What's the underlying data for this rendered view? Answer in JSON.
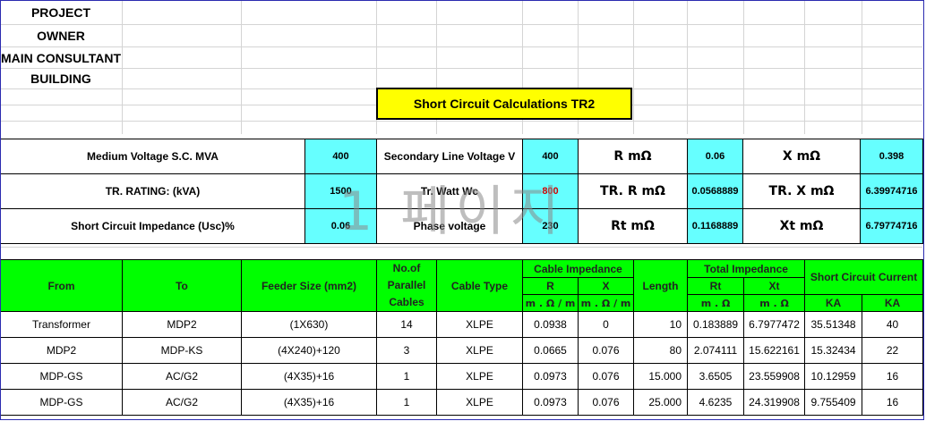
{
  "info_labels": [
    "PROJECT",
    "OWNER",
    "MAIN CONSULTANT",
    "BUILDING"
  ],
  "title": "Short Circuit Calculations TR2",
  "params": {
    "mv_label": "Medium Voltage S.C. MVA",
    "mv_value": "400",
    "slv_label": "Secondary Line Voltage V",
    "slv_value": "400",
    "r_label": "R  mΩ",
    "r_value": "0.06",
    "x_label": "X  mΩ",
    "x_value": "0.398",
    "rating_label": "TR. RATING: (kVA)",
    "rating_value": "1500",
    "watt_label": "Tr. Watt Wc",
    "watt_value": "800",
    "trr_label": "TR. R  mΩ",
    "trr_value": "0.0568889",
    "trx_label": "TR. X  mΩ",
    "trx_value": "6.39974716",
    "usc_label": "Short Circuit Impedance (Usc)%",
    "usc_value": "0.06",
    "phase_label": "Phase voltage",
    "phase_value": "230",
    "rt_label": "Rt   mΩ",
    "rt_value": "0.1168889",
    "xt_label": "Xt   mΩ",
    "xt_value": "6.79774716"
  },
  "watermark": "1 페이지",
  "feeder_headers": {
    "from": "From",
    "to": "To",
    "feeder_size": "Feeder Size (mm2)",
    "parallel": "No.of Parallel Cables",
    "cable_type": "Cable Type",
    "cable_impedance": "Cable Impedance",
    "r": "R",
    "x": "X",
    "r_unit": "m . Ω / m",
    "x_unit": "m . Ω / m",
    "length": "Length",
    "total_impedance": "Total Impedance",
    "rt": "Rt",
    "xt": "Xt",
    "rt_unit": "m . Ω",
    "xt_unit": "m . Ω",
    "sc_current": "Short Circuit Current",
    "ka1": "KA",
    "ka2": "KA"
  },
  "feeder_rows": [
    {
      "from": "Transformer",
      "to": "MDP2",
      "size": "(1X630)",
      "parallel": "14",
      "type": "XLPE",
      "r": "0.0938",
      "x": "0",
      "length": "10",
      "rt": "0.183889",
      "xt": "6.7977472",
      "ka": "35.51348",
      "ka_rated": "40"
    },
    {
      "from": "MDP2",
      "to": "MDP-KS",
      "size": "(4X240)+120",
      "parallel": "3",
      "type": "XLPE",
      "r": "0.0665",
      "x": "0.076",
      "length": "80",
      "rt": "2.074111",
      "xt": "15.622161",
      "ka": "15.32434",
      "ka_rated": "22"
    },
    {
      "from": "MDP-GS",
      "to": "AC/G2",
      "size": "(4X35)+16",
      "parallel": "1",
      "type": "XLPE",
      "r": "0.0973",
      "x": "0.076",
      "length": "15.000",
      "rt": "3.6505",
      "xt": "23.559908",
      "ka": "10.12959",
      "ka_rated": "16"
    },
    {
      "from": "MDP-GS",
      "to": "AC/G2",
      "size": "(4X35)+16",
      "parallel": "1",
      "type": "XLPE",
      "r": "0.0973",
      "x": "0.076",
      "length": "25.000",
      "rt": "4.6235",
      "xt": "24.319908",
      "ka": "9.755409",
      "ka_rated": "16"
    }
  ]
}
